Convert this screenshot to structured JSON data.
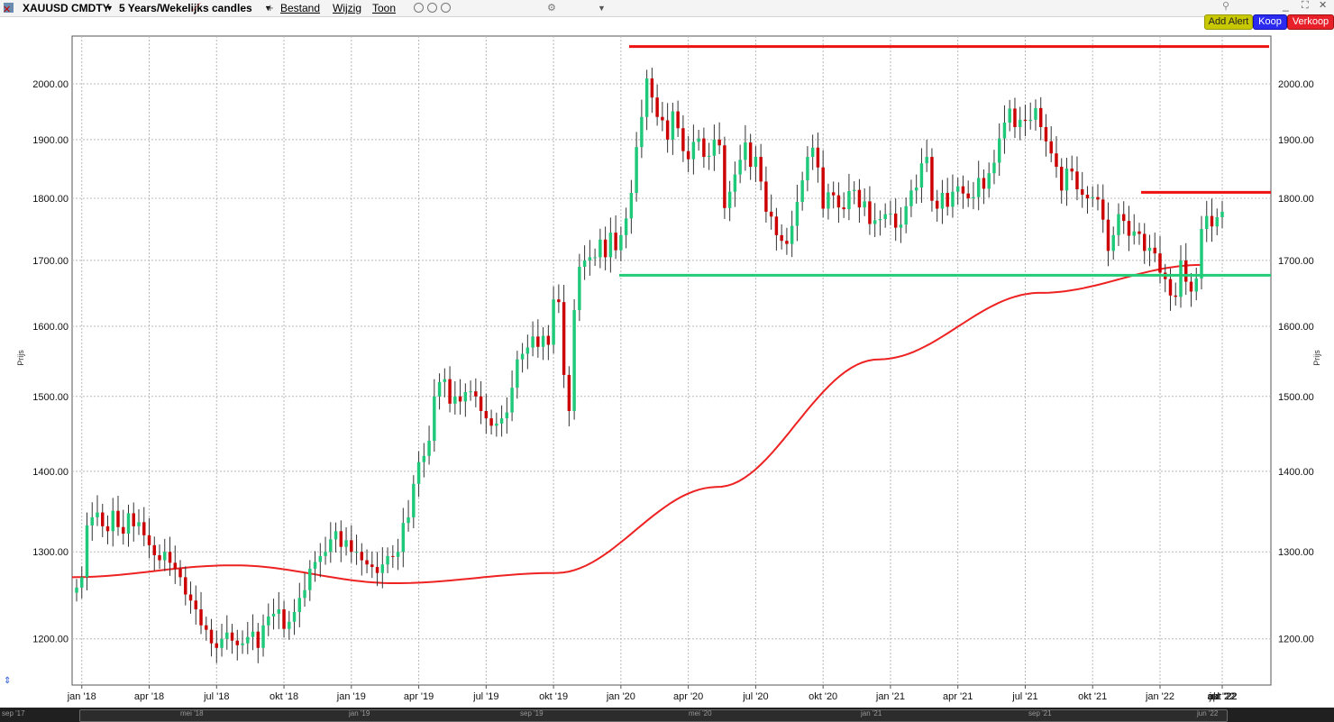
{
  "toolbar": {
    "symbol": "XAUUSD CMDTY",
    "timeframe": "5 Years/Wekelijks candles",
    "menus": [
      "Bestand",
      "Wijzig",
      "Toon"
    ],
    "add_alert_label": "Add Alert",
    "buy_label": "Koop",
    "sell_label": "Verkoop",
    "colors": {
      "add_alert": "#c8c800",
      "buy": "#2a2af0",
      "sell": "#e8202a"
    }
  },
  "chart_data": {
    "type": "candlestick",
    "y_axis": {
      "label": "Prijs",
      "scale": "log",
      "range": [
        1150,
        2090
      ],
      "ticks": [
        "1200.00",
        "1300.00",
        "1400.00",
        "1500.00",
        "1600.00",
        "1700.00",
        "1800.00",
        "1900.00",
        "2000.00"
      ],
      "position": "both"
    },
    "x_axis": {
      "labels": [
        "jan '18",
        "apr '18",
        "jul '18",
        "okt '18",
        "jan '19",
        "apr '19",
        "jul '19",
        "okt '19",
        "jan '20",
        "apr '20",
        "jul '20",
        "okt '20",
        "jan '21",
        "apr '21",
        "jul '21",
        "okt '21",
        "jan '22",
        "apr '22",
        "jul '22",
        "okt '22"
      ]
    },
    "grid": true,
    "colors": {
      "up": "#1fc97a",
      "down": "#cc0000",
      "moving_average": "#ee2222",
      "resistance": "#ee1111",
      "support": "#22cc77"
    },
    "weekly_closes": [
      1258,
      1270,
      1332,
      1342,
      1348,
      1331,
      1325,
      1350,
      1330,
      1322,
      1347,
      1331,
      1336,
      1320,
      1308,
      1296,
      1290,
      1300,
      1287,
      1280,
      1270,
      1250,
      1243,
      1233,
      1215,
      1210,
      1195,
      1190,
      1200,
      1207,
      1198,
      1193,
      1195,
      1202,
      1208,
      1190,
      1215,
      1225,
      1228,
      1233,
      1211,
      1219,
      1230,
      1246,
      1255,
      1280,
      1288,
      1295,
      1300,
      1315,
      1325,
      1306,
      1314,
      1300,
      1300,
      1290,
      1285,
      1282,
      1275,
      1285,
      1295,
      1294,
      1300,
      1335,
      1342,
      1384,
      1412,
      1420,
      1440,
      1500,
      1520,
      1524,
      1490,
      1500,
      1493,
      1506,
      1507,
      1500,
      1480,
      1470,
      1460,
      1463,
      1470,
      1478,
      1512,
      1552,
      1560,
      1569,
      1585,
      1570,
      1586,
      1573,
      1640,
      1636,
      1530,
      1480,
      1624,
      1690,
      1700,
      1705,
      1705,
      1733,
      1705,
      1744,
      1716,
      1740,
      1767,
      1809,
      1887,
      1940,
      2010,
      1975,
      1940,
      1934,
      1900,
      1950,
      1920,
      1880,
      1866,
      1896,
      1902,
      1870,
      1872,
      1900,
      1890,
      1784,
      1811,
      1840,
      1865,
      1895,
      1853,
      1870,
      1828,
      1778,
      1770,
      1740,
      1731,
      1726,
      1755,
      1794,
      1830,
      1870,
      1886,
      1852,
      1783,
      1810,
      1805,
      1785,
      1782,
      1812,
      1814,
      1785,
      1795,
      1758,
      1764,
      1766,
      1774,
      1775,
      1752,
      1757,
      1787,
      1813,
      1818,
      1859,
      1870,
      1796,
      1783,
      1809,
      1786,
      1811,
      1820,
      1808,
      1800,
      1802,
      1834,
      1816,
      1842,
      1860,
      1902,
      1930,
      1955,
      1922,
      1935,
      1933,
      1935,
      1956,
      1922,
      1897,
      1876,
      1853,
      1813,
      1850,
      1845,
      1815,
      1806,
      1800,
      1802,
      1798,
      1765,
      1715,
      1740,
      1774,
      1763,
      1739,
      1746,
      1742,
      1715,
      1720,
      1711,
      1681,
      1671,
      1646,
      1644,
      1700,
      1667,
      1652,
      1672,
      1750,
      1771,
      1754,
      1769,
      1778
    ],
    "moving_average_200": {
      "name": "",
      "approx_values": [
        1270,
        1284,
        1263,
        1275,
        1380,
        1552,
        1650,
        1693
      ]
    },
    "horizontal_lines": [
      {
        "role": "resistance",
        "value": 2070
      },
      {
        "role": "resistance",
        "value": 1810
      },
      {
        "role": "support",
        "value": 1677
      }
    ]
  },
  "navigator": {
    "labels": [
      "sep '17",
      "mei '18",
      "jan '19",
      "sep '19",
      "mei '20",
      "jan '21",
      "sep '21",
      "jun '22"
    ]
  }
}
